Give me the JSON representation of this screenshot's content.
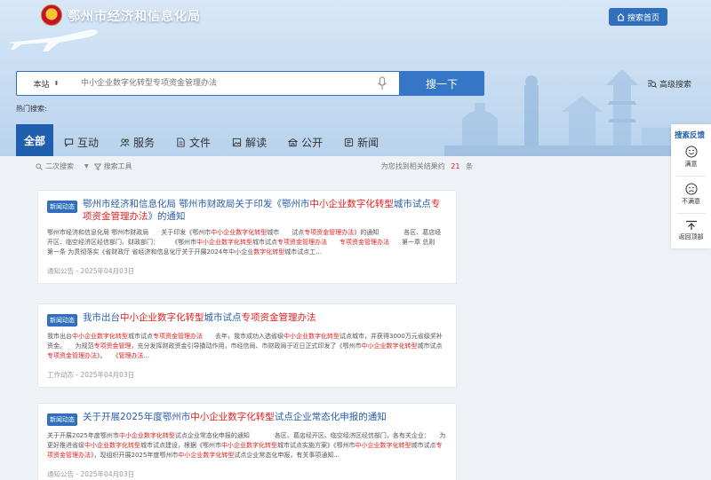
{
  "header": {
    "site_title": "鄂州市经济和信息化局",
    "home_label": "搜索首页"
  },
  "search": {
    "scope_label": "本站",
    "placeholder": "中小企业数字化转型专项资金管理办法",
    "button_label": "搜一下",
    "advanced_label": "高级搜索",
    "hot_label": "热门搜索:"
  },
  "tabs": [
    {
      "label": "全部",
      "icon": "none"
    },
    {
      "label": "互动",
      "icon": "chat-icon"
    },
    {
      "label": "服务",
      "icon": "service-icon"
    },
    {
      "label": "文件",
      "icon": "file-icon"
    },
    {
      "label": "解读",
      "icon": "image-icon"
    },
    {
      "label": "公开",
      "icon": "public-icon"
    },
    {
      "label": "新闻",
      "icon": "news-icon"
    }
  ],
  "results_bar": {
    "secondary_search": "二次搜索",
    "search_tools": "搜索工具",
    "found_prefix": "为您找到相关结果约",
    "count": "21",
    "found_suffix": "条"
  },
  "results": [
    {
      "badge": "新闻动态",
      "title": [
        {
          "t": "鄂州市经济和信息化局 鄂州市财政局关于印发《鄂州市",
          "h": false
        },
        {
          "t": "中小企业数字化转型",
          "h": true
        },
        {
          "t": "城市试点",
          "h": false
        },
        {
          "t": "专项资金管理办法",
          "h": true
        },
        {
          "t": "》的通知",
          "h": false
        }
      ],
      "body": [
        {
          "t": "鄂州市经济和信息化局 鄂州市财政局　　关于印发《鄂州市",
          "h": false
        },
        {
          "t": "中小企业数字化转型",
          "h": true
        },
        {
          "t": "城市　　试点",
          "h": false
        },
        {
          "t": "专项资金管理办法",
          "h": true
        },
        {
          "t": "》的通知　　　　各区、葛店经开区、临空经济区经信部门、财政部门：　　　《鄂州市",
          "h": false
        },
        {
          "t": "中小企业数字化转型",
          "h": true
        },
        {
          "t": "城市试点",
          "h": false
        },
        {
          "t": "专项资金管理办法",
          "h": true
        },
        {
          "t": "　　",
          "h": false
        },
        {
          "t": "专项资金管理办法",
          "h": true
        },
        {
          "t": "　　第一章 总则　　第一条 为贯彻落实《省财政厅 省经济和信息化厅关于开展2024年中小企业",
          "h": false
        },
        {
          "t": "数字化转型",
          "h": true
        },
        {
          "t": "城市试点工...",
          "h": false
        }
      ],
      "meta": "通知公告 - 2025年04月03日"
    },
    {
      "badge": "新闻动态",
      "title": [
        {
          "t": "我市出台",
          "h": false
        },
        {
          "t": "中小企业数字化转型",
          "h": true
        },
        {
          "t": "城市试点",
          "h": false
        },
        {
          "t": "专项资金管理办法",
          "h": true
        }
      ],
      "body": [
        {
          "t": "我市出台",
          "h": false
        },
        {
          "t": "中小企业数字化转型",
          "h": true
        },
        {
          "t": "城市试点",
          "h": false
        },
        {
          "t": "专项资金管理办法",
          "h": true
        },
        {
          "t": "　　去年，我市成功入选省级",
          "h": false
        },
        {
          "t": "中小企业数字化转型",
          "h": true
        },
        {
          "t": "试点城市，并获得3000万元省级奖补资金。　　为规范",
          "h": false
        },
        {
          "t": "专项资金管理",
          "h": true
        },
        {
          "t": "，充分发挥财政资金引导撬动作用，市经信局、市财政局于近日正式印发了《鄂州市",
          "h": false
        },
        {
          "t": "中小企业数字化转型",
          "h": true
        },
        {
          "t": "城市试点",
          "h": false
        },
        {
          "t": "专项资金管理办法",
          "h": true
        },
        {
          "t": "》。　　《",
          "h": false
        },
        {
          "t": "管理办法",
          "h": true
        },
        {
          "t": "...",
          "h": false
        }
      ],
      "meta": "工作动态 - 2025年04月03日"
    },
    {
      "badge": "新闻动态",
      "title": [
        {
          "t": "关于开展2025年度鄂州市",
          "h": false
        },
        {
          "t": "中小企业数字化转型",
          "h": true
        },
        {
          "t": "试点企业常态化申报的通知",
          "h": false
        }
      ],
      "body": [
        {
          "t": "关于开展2025年度鄂州市",
          "h": false
        },
        {
          "t": "中小企业数字化转型",
          "h": true
        },
        {
          "t": "试点企业常态化申报的通知　　　　各区、葛店经开区、临空经济区经信部门，各有关企业：　　为更好推进省级",
          "h": false
        },
        {
          "t": "中小企业数字化转型",
          "h": true
        },
        {
          "t": "城市试点建设，根据《鄂州市",
          "h": false
        },
        {
          "t": "中小企业数字化转型",
          "h": true
        },
        {
          "t": "城市试点实施方案》《鄂州市",
          "h": false
        },
        {
          "t": "中小企业数字化转型",
          "h": true
        },
        {
          "t": "城市试点",
          "h": false
        },
        {
          "t": "专项资金管理办法",
          "h": true
        },
        {
          "t": "》，现组织开展2025年度鄂州市",
          "h": false
        },
        {
          "t": "中小企业数字化转型",
          "h": true
        },
        {
          "t": "试点企业常态化申报，有关事项通知...",
          "h": false
        }
      ],
      "meta": "通知公告 - 2025年04月03日"
    }
  ],
  "sidebar": {
    "title": "搜索反馈",
    "satisfied": "满意",
    "unsatisfied": "不满意",
    "back_top": "返回顶部"
  }
}
